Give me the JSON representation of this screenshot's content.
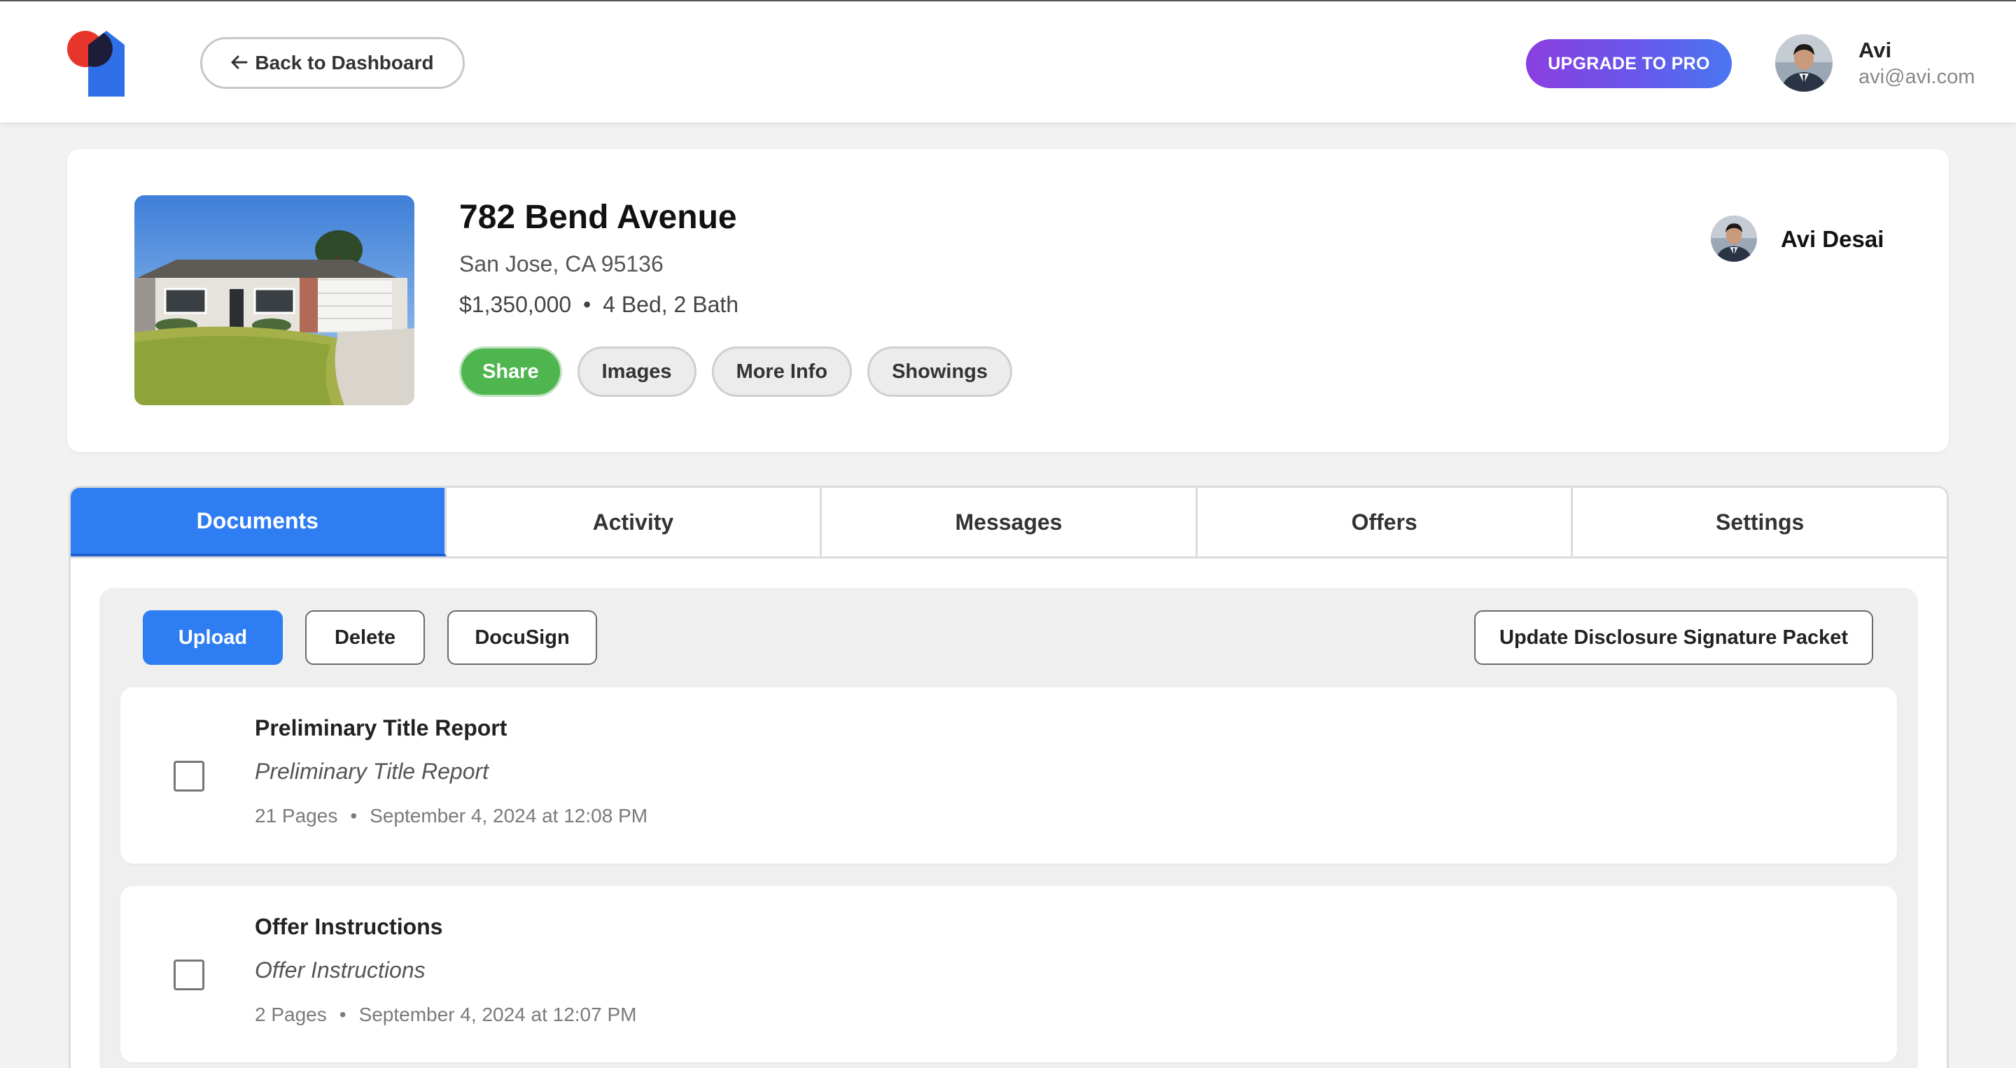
{
  "header": {
    "back_label": "Back to Dashboard",
    "upgrade_label": "UPGRADE TO PRO",
    "user": {
      "name": "Avi",
      "email": "avi@avi.com"
    }
  },
  "property": {
    "title": "782 Bend Avenue",
    "city": "San Jose, CA 95136",
    "price": "$1,350,000",
    "separator": "•",
    "beds_baths": "4 Bed, 2 Bath",
    "actions": [
      {
        "label": "Share",
        "color": "#4fb54f"
      },
      {
        "label": "Images"
      },
      {
        "label": "More Info"
      },
      {
        "label": "Showings"
      }
    ],
    "agent_name": "Avi Desai"
  },
  "tabs": [
    {
      "label": "Documents",
      "active": true
    },
    {
      "label": "Activity"
    },
    {
      "label": "Messages"
    },
    {
      "label": "Offers"
    },
    {
      "label": "Settings"
    }
  ],
  "toolbar": {
    "upload_label": "Upload",
    "delete_label": "Delete",
    "docusign_label": "DocuSign",
    "update_packet_label": "Update Disclosure Signature Packet"
  },
  "documents": [
    {
      "title": "Preliminary Title Report",
      "subtitle": "Preliminary Title Report",
      "pages": "21 Pages",
      "separator": "•",
      "date": "September 4, 2024 at 12:08 PM",
      "checked": false
    },
    {
      "title": "Offer Instructions",
      "subtitle": "Offer Instructions",
      "pages": "2 Pages",
      "separator": "•",
      "date": "September 4, 2024 at 12:07 PM",
      "checked": false
    }
  ],
  "colors": {
    "accent": "#2f7df2",
    "share_green": "#4fb54f",
    "upgrade_gradient_start": "#8b3fe0",
    "upgrade_gradient_end": "#4a76f2"
  }
}
